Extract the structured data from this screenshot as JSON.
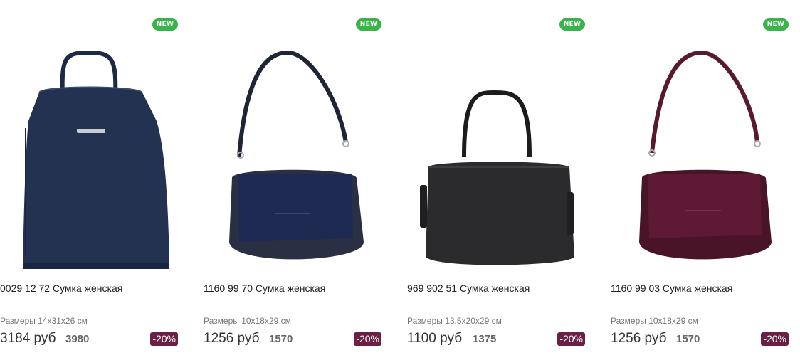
{
  "products": [
    {
      "badge": "NEW",
      "title": "0029 12 72 Сумка женская",
      "sizes": "Размеры 14x31x26 см",
      "price": "3184 руб",
      "old_price": "3980",
      "discount": "-20%",
      "image_icon": "backpack-navy-image"
    },
    {
      "badge": "NEW",
      "title": "1160 99 70 Сумка женская",
      "sizes": "Размеры 10x18x29 см",
      "price": "1256 руб",
      "old_price": "1570",
      "discount": "-20%",
      "image_icon": "shoulder-bag-navy-image"
    },
    {
      "badge": "NEW",
      "title": "969 902 51 Сумка женская",
      "sizes": "Размеры 13.5x20x29 см",
      "price": "1100 руб",
      "old_price": "1375",
      "discount": "-20%",
      "image_icon": "tote-bag-black-image"
    },
    {
      "badge": "NEW",
      "title": "1160 99 03 Сумка женская",
      "sizes": "Размеры 10x18x29 см",
      "price": "1256 руб",
      "old_price": "1570",
      "discount": "-20%",
      "image_icon": "shoulder-bag-burgundy-image"
    }
  ],
  "colors": {
    "new_badge": "#38b44a",
    "discount_badge": "#6b1f45"
  }
}
